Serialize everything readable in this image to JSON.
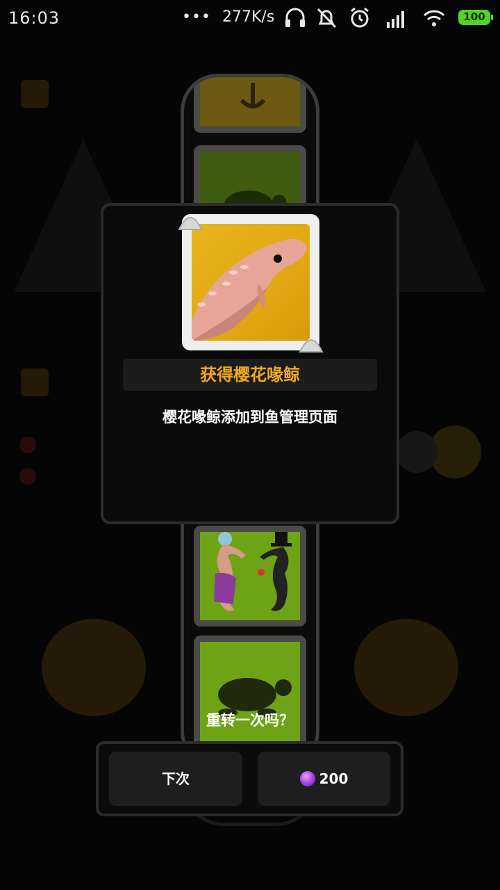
{
  "status_bar": {
    "time": "16:03",
    "dots": "•••",
    "network_speed": "277K/s",
    "icons": [
      "headset-icon",
      "bell-muted-icon",
      "alarm-icon",
      "signal-icon",
      "wifi-icon"
    ],
    "battery": "100"
  },
  "reel": {
    "tiles": [
      "anchor-icon",
      "turtle-icon",
      "seahorse-couple-icon",
      "turtle-icon"
    ]
  },
  "reward_modal": {
    "item_image": "sakura-whale-icon",
    "title": "获得樱花喙鲸",
    "description": "樱花喙鲸添加到鱼管理页面"
  },
  "respin": {
    "prompt": "重转一次吗？",
    "next_label": "下次",
    "cost_value": "200",
    "cost_icon": "purple-gem-icon"
  },
  "colors": {
    "title": "#f1a820",
    "tile_green": "#6ea317",
    "tile_yellow": "#e2a812",
    "battery": "#54d12b"
  }
}
